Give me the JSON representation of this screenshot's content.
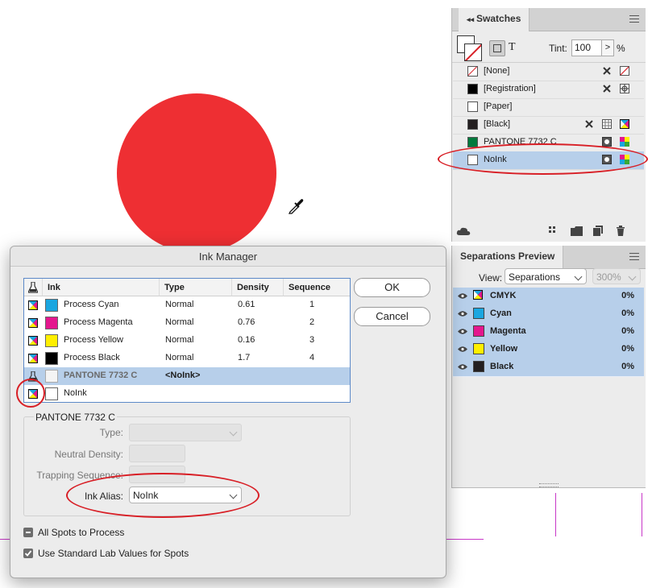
{
  "swatches": {
    "tab": "Swatches",
    "tint_label": "Tint:",
    "tint_value": "100",
    "tint_unit": "%",
    "type_button": "T",
    "items": [
      {
        "name": "[None]",
        "color": "none"
      },
      {
        "name": "[Registration]",
        "color": "#000000"
      },
      {
        "name": "[Paper]",
        "color": "#ffffff"
      },
      {
        "name": "[Black]",
        "color": "#231f20"
      },
      {
        "name": "PANTONE 7732 C",
        "color": "#007a3d"
      },
      {
        "name": "NoInk",
        "color": "#ffffff",
        "selected": true
      }
    ]
  },
  "separations": {
    "tab": "Separations Preview",
    "view_label": "View:",
    "view_value": "Separations",
    "zoom_value": "300%",
    "items": [
      {
        "name": "CMYK",
        "pct": "0%",
        "color": "cmyk"
      },
      {
        "name": "Cyan",
        "pct": "0%",
        "color": "#1aa6e0"
      },
      {
        "name": "Magenta",
        "pct": "0%",
        "color": "#e4178e"
      },
      {
        "name": "Yellow",
        "pct": "0%",
        "color": "#ffef00"
      },
      {
        "name": "Black",
        "pct": "0%",
        "color": "#231f20"
      }
    ]
  },
  "ink_manager": {
    "title": "Ink Manager",
    "columns": {
      "ink": "Ink",
      "type": "Type",
      "density": "Density",
      "sequence": "Sequence"
    },
    "rows": [
      {
        "name": "Process Cyan",
        "type": "Normal",
        "density": "0.61",
        "sequence": "1",
        "color": "#1aa6e0"
      },
      {
        "name": "Process Magenta",
        "type": "Normal",
        "density": "0.76",
        "sequence": "2",
        "color": "#e4178e"
      },
      {
        "name": "Process Yellow",
        "type": "Normal",
        "density": "0.16",
        "sequence": "3",
        "color": "#ffef00"
      },
      {
        "name": "Process Black",
        "type": "Normal",
        "density": "1.7",
        "sequence": "4",
        "color": "#000000"
      },
      {
        "name": "PANTONE 7732 C",
        "type": "<NoInk>",
        "density": "",
        "sequence": "",
        "color": "#f4f4f4",
        "selected": true
      },
      {
        "name": "NoInk",
        "type": "",
        "density": "",
        "sequence": "",
        "color": "#ffffff"
      }
    ],
    "ok_label": "OK",
    "cancel_label": "Cancel",
    "selected_ink_title": "PANTONE 7732 C",
    "type_label": "Type:",
    "neutral_density_label": "Neutral Density:",
    "trapping_sequence_label": "Trapping Sequence:",
    "ink_alias_label": "Ink Alias:",
    "ink_alias_value": "NoInk",
    "all_spots_label": "All Spots to Process",
    "all_spots_checked": false,
    "lab_values_label": "Use Standard Lab Values for Spots",
    "lab_values_checked": true
  },
  "colors": {
    "circle": "#ee2f33",
    "highlight": "#d81f26",
    "selection": "#b7cfea"
  }
}
